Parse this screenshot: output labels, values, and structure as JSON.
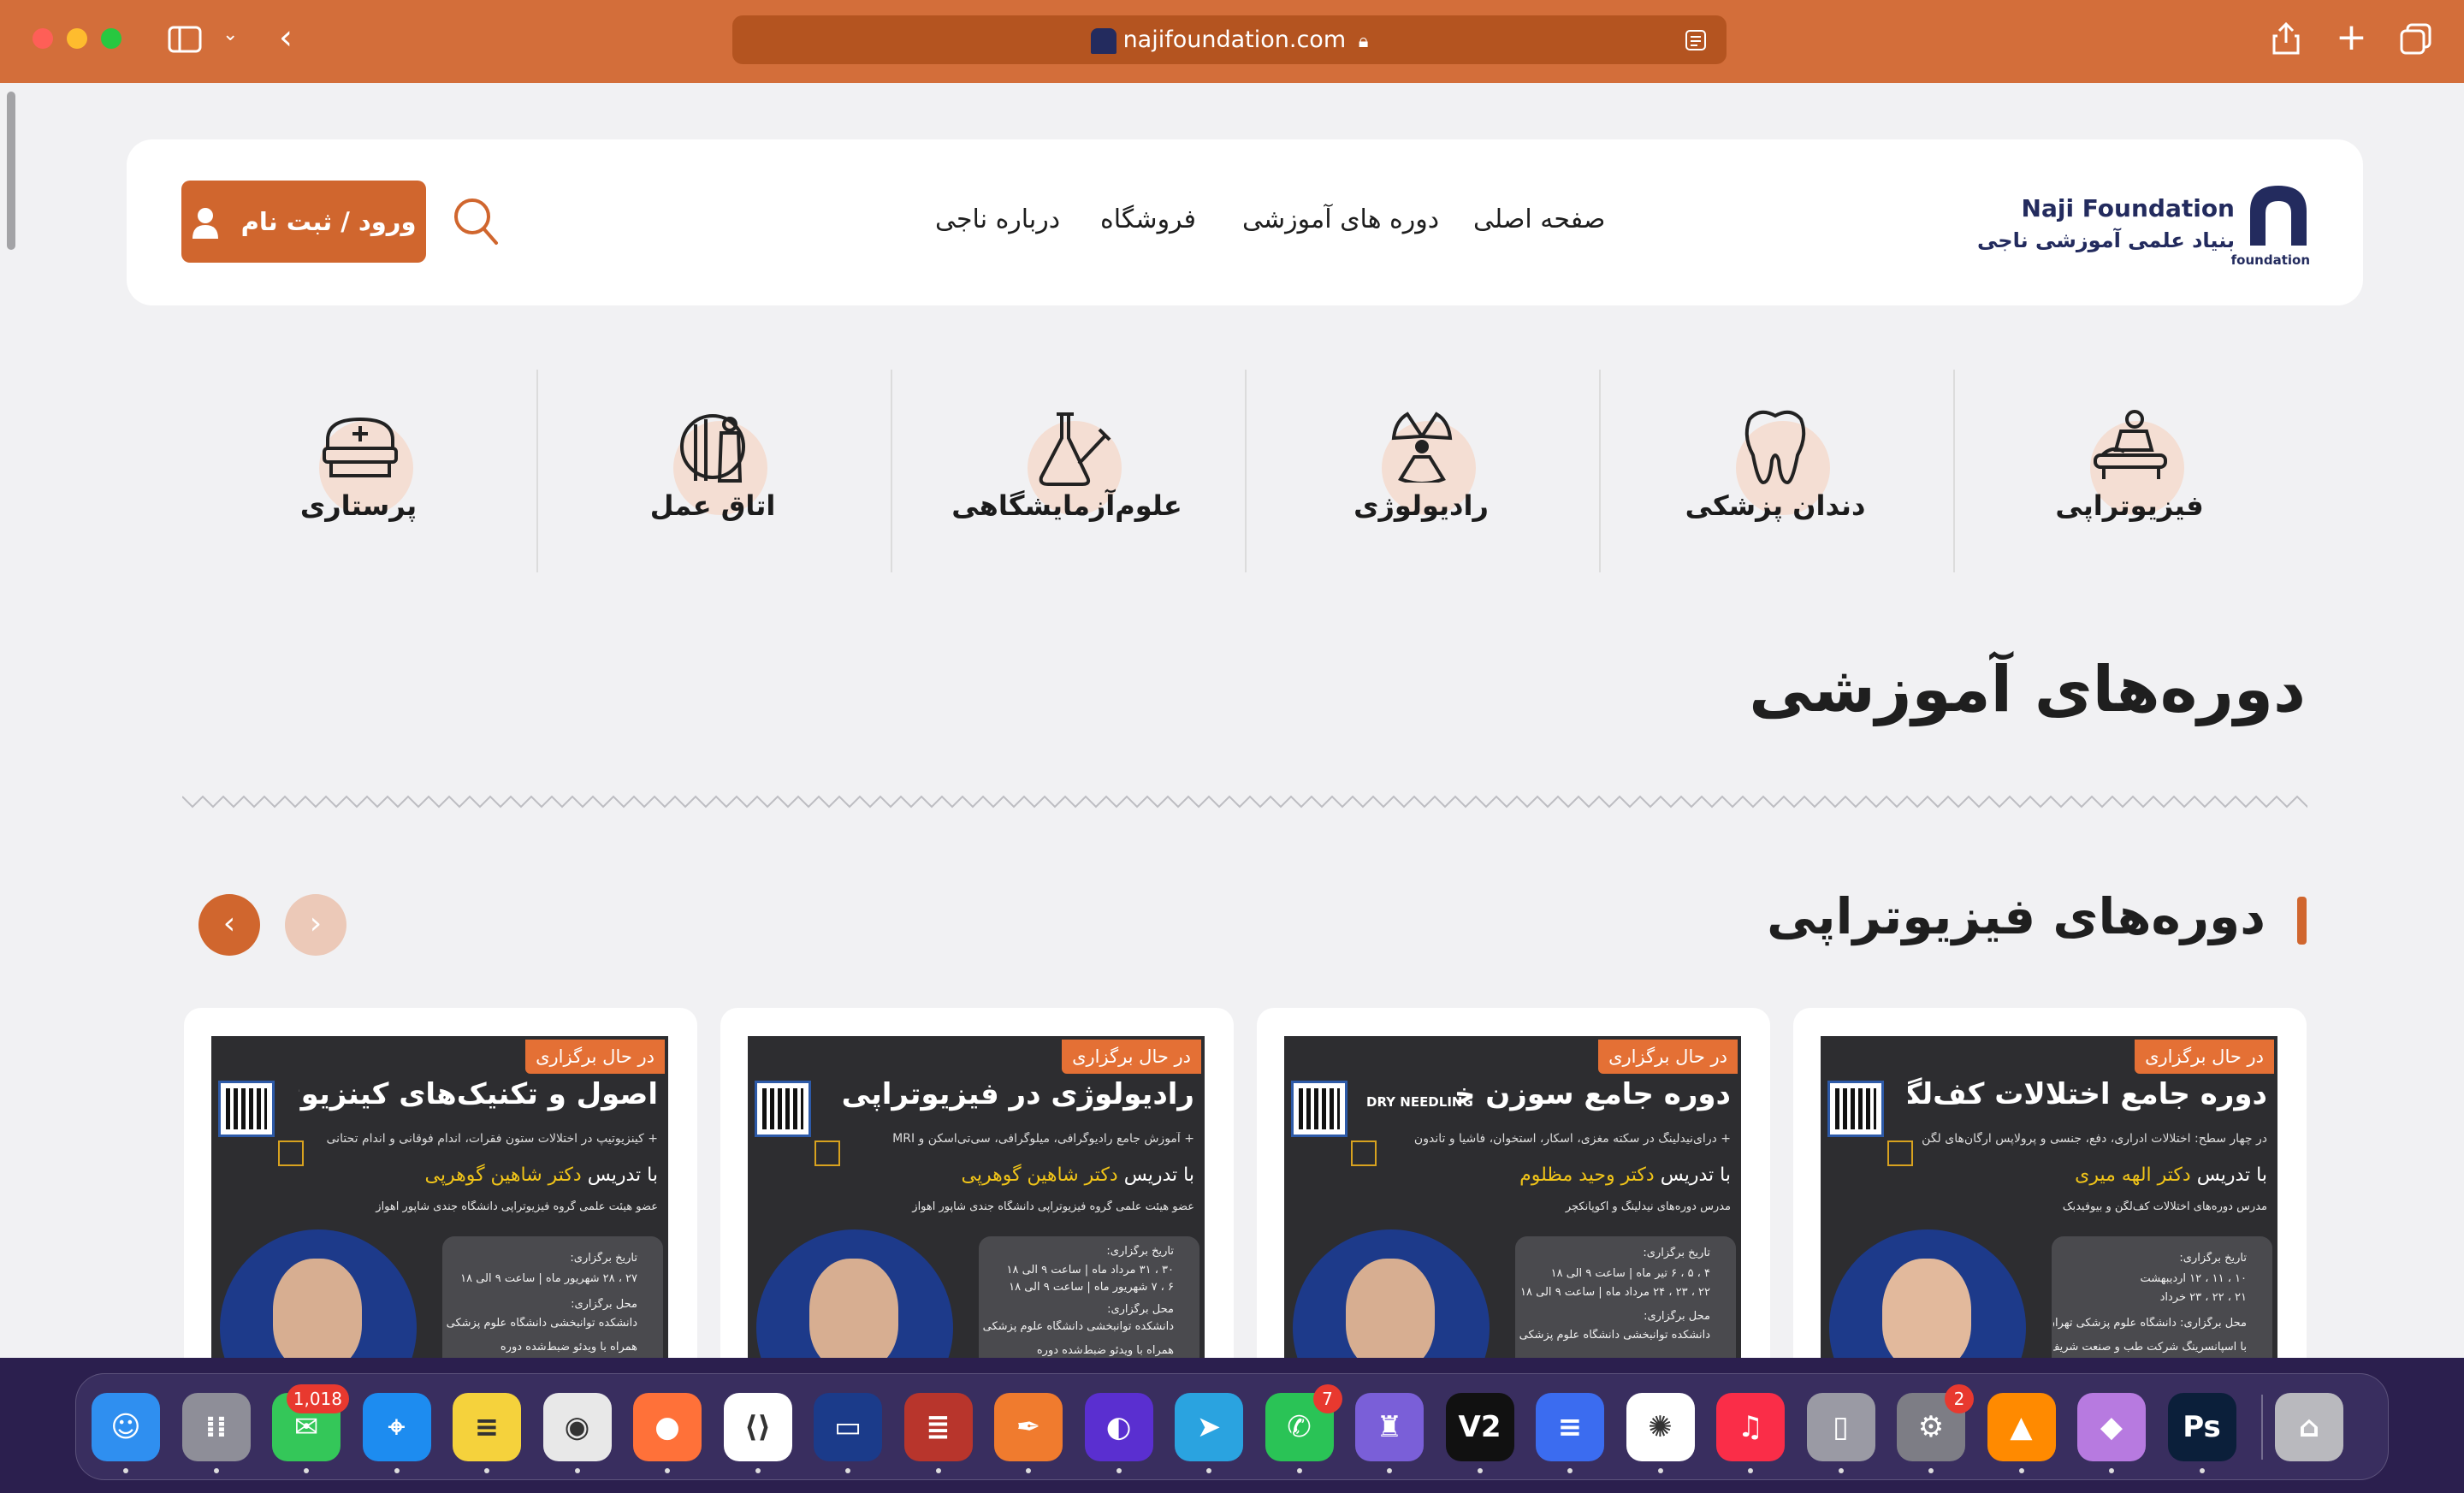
{
  "browser": {
    "url": "najifoundation.com"
  },
  "site": {
    "brand_en": "Naji Foundation",
    "brand_fa": "بنیاد علمی آموزشی ناجی",
    "logo_sub": "foundation",
    "login_label": "ورود / ثبت نام",
    "nav": [
      "صفحه اصلی",
      "دوره های آموزشی",
      "فروشگاه",
      "درباره ناجی"
    ]
  },
  "categories": [
    {
      "label": "فیزیوتراپی",
      "icon": "physiotherapy-icon"
    },
    {
      "label": "دندان پزشکی",
      "icon": "tooth-icon"
    },
    {
      "label": "رادیولوژی",
      "icon": "radiation-icon"
    },
    {
      "label": "علوم‌آزمایشگاهی",
      "icon": "lab-flask-icon"
    },
    {
      "label": "اتاق عمل",
      "icon": "surgery-tools-icon"
    },
    {
      "label": "پرستاری",
      "icon": "nurse-cap-icon"
    }
  ],
  "section_title": "دوره‌های آموزشی",
  "subsection_title": "دوره‌های فیزیوتراپی",
  "courses": [
    {
      "badge": "در حال برگزاری",
      "title": "دوره جامع اختلالات کف‌لگن",
      "desc": "در چهار سطح: اختلالات ادراری، دفع، جنسی و پرولاپس ارگان‌های لگن",
      "teacher_prefix": "با تدریس",
      "teacher": "دکتر الهه میری",
      "affil": "مدرس دوره‌های اختلالات کف‌لگن و بیوفیدبک",
      "info": [
        "تاریخ برگزاری:",
        "۱۰ ، ۱۱ ، ۱۲ اردیبهشت",
        "۲۱ ، ۲۲ ، ۲۳ خرداد",
        "محل برگزاری: دانشگاه علوم پزشکی تهران",
        "با اسپانسرینگ شرکت طب و صنعت شریف"
      ]
    },
    {
      "badge": "در حال برگزاری",
      "title": "دوره جامع سوزن خشک",
      "title_en": "DRY NEEDLING",
      "desc": "+ درای‌نیدلینگ در سکته مغزی، اسکار، استخوان، فاشیا و تاندون",
      "teacher_prefix": "با تدریس",
      "teacher": "دکتر وحید مظلوم",
      "affil": "مدرس دوره‌های نیدلینگ و آکوپانکچر",
      "info": [
        "تاریخ برگزاری:",
        "۴ ، ۵ ، ۶ تیر ماه | ساعت ۹ الی ۱۸",
        "۲۲ ، ۲۳ ، ۲۴ مرداد ماه | ساعت ۹ الی ۱۸",
        "محل برگزاری:",
        "دانشکده توانبخشی دانشگاه علوم پزشکی تهران"
      ]
    },
    {
      "badge": "در حال برگزاری",
      "title": "رادیولوژی در فیزیوتراپی",
      "desc": "+ آموزش جامع رادیوگرافی، میلوگرافی، سی‌تی‌اسکن و MRI",
      "teacher_prefix": "با تدریس",
      "teacher": "دکتر شاهین گوهرپی",
      "affil": "عضو هیئت علمی گروه فیزیوتراپی دانشگاه جندی شاپور اهواز",
      "info": [
        "تاریخ برگزاری:",
        "۳۰ ، ۳۱ مرداد ماه | ساعت ۹ الی ۱۸",
        "۶ ، ۷ شهریور ماه | ساعت ۹ الی ۱۸",
        "محل برگزاری:",
        "دانشکده توانبخشی دانشگاه علوم پزشکی تهران",
        "همراه با ویدئو ضبط‌شده دوره"
      ]
    },
    {
      "badge": "در حال برگزاری",
      "title": "اصول و تکنیک‌های کینزیوتیپ",
      "desc": "+ کینزیوتیپ در اختلالات ستون فقرات، اندام فوقانی و اندام تحتانی",
      "teacher_prefix": "با تدریس",
      "teacher": "دکتر شاهین گوهرپی",
      "affil": "عضو هیئت علمی گروه فیزیوتراپی دانشگاه جندی شاپور اهواز",
      "info": [
        "تاریخ برگزاری:",
        "۲۷ ، ۲۸ شهریور ماه | ساعت ۹ الی ۱۸",
        "محل برگزاری:",
        "دانشکده توانبخشی دانشگاه علوم پزشکی تهران",
        "همراه با ویدئو ضبط‌شده دوره"
      ]
    }
  ],
  "dock": [
    {
      "name": "finder",
      "color": "#2f8ff0",
      "glyph": "☺"
    },
    {
      "name": "launchpad",
      "color": "#8e8e98",
      "glyph": "⁞⁞"
    },
    {
      "name": "messages",
      "color": "#34c759",
      "glyph": "✉",
      "badge": "1,018"
    },
    {
      "name": "safari",
      "color": "#1d8cf0",
      "glyph": "⌖"
    },
    {
      "name": "notes",
      "color": "#f5d23c",
      "glyph": "≡"
    },
    {
      "name": "chrome",
      "color": "#e8e8e8",
      "glyph": "◉"
    },
    {
      "name": "firefox",
      "color": "#ff7139",
      "glyph": "●"
    },
    {
      "name": "vscode",
      "color": "#ffffff",
      "glyph": "⟨⟩"
    },
    {
      "name": "app-dark-blue",
      "color": "#1b3b8a",
      "glyph": "▭"
    },
    {
      "name": "database",
      "color": "#b8352c",
      "glyph": "≣"
    },
    {
      "name": "pen-tool",
      "color": "#f07b2e",
      "glyph": "✒"
    },
    {
      "name": "eclipse",
      "color": "#5a2fd0",
      "glyph": "◐"
    },
    {
      "name": "telegram",
      "color": "#2aa3e0",
      "glyph": "➤"
    },
    {
      "name": "whatsapp",
      "color": "#2ac356",
      "glyph": "✆",
      "badge": "7"
    },
    {
      "name": "vpn",
      "color": "#7a5fd8",
      "glyph": "♜"
    },
    {
      "name": "v2",
      "color": "#111111",
      "glyph": "V2"
    },
    {
      "name": "docs",
      "color": "#3b6cf0",
      "glyph": "≡"
    },
    {
      "name": "chatgpt",
      "color": "#ffffff",
      "glyph": "✺"
    },
    {
      "name": "music",
      "color": "#fa2d48",
      "glyph": "♫"
    },
    {
      "name": "iphone-mirroring",
      "color": "#9a9aa4",
      "glyph": "▯"
    },
    {
      "name": "system-settings",
      "color": "#7d7d85",
      "glyph": "⚙",
      "badge": "2"
    },
    {
      "name": "vlc",
      "color": "#ff8a00",
      "glyph": "▲"
    },
    {
      "name": "drop-app",
      "color": "#b77ae0",
      "glyph": "◆"
    },
    {
      "name": "photoshop",
      "color": "#0b1f3a",
      "glyph": "Ps"
    },
    {
      "name": "trash",
      "color": "#b9b9be",
      "glyph": "⌂"
    }
  ]
}
